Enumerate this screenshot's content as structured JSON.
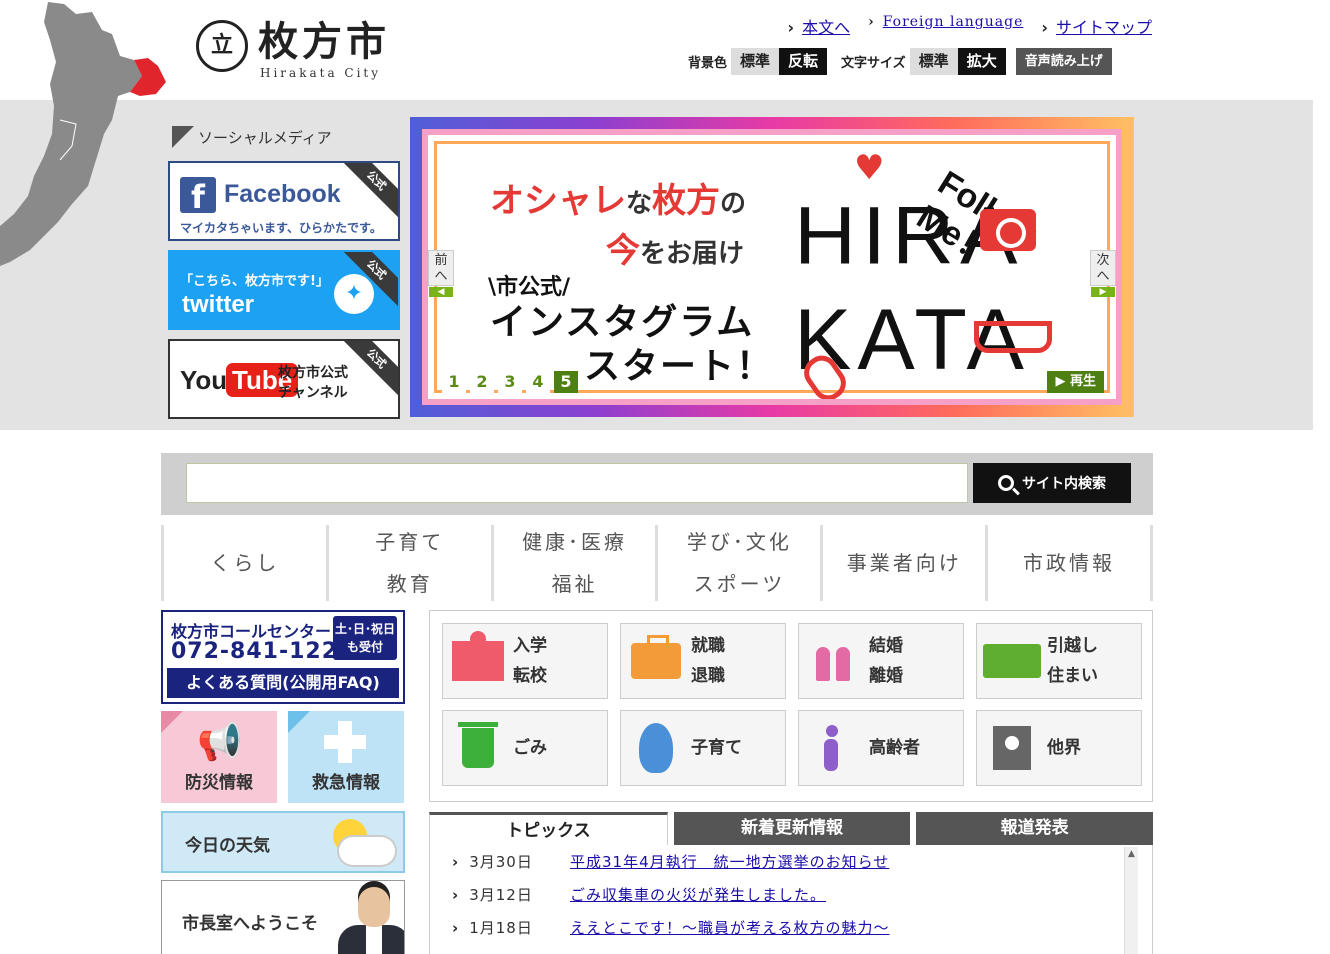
{
  "header": {
    "logo_mark": "立",
    "logo_name": "枚方市",
    "logo_roman": "Hirakata City",
    "links": [
      "本文へ",
      "Foreign language",
      "サイトマップ"
    ],
    "bg_label": "背景色",
    "bg_normal": "標準",
    "bg_invert": "反転",
    "size_label": "文字サイズ",
    "size_normal": "標準",
    "size_large": "拡大",
    "voice": "音声読み上げ"
  },
  "social": {
    "heading": "ソーシャルメディア",
    "corner": "公式",
    "facebook_title": "Facebook",
    "facebook_sub": "マイカタちゃいます、ひらかたです。",
    "twitter_sub": "「こちら、枚方市です!」",
    "twitter_title": "twitter",
    "youtube_you": "You",
    "youtube_tube": "Tube",
    "youtube_line1": "枚方市公式",
    "youtube_line2": "チャンネル"
  },
  "banner": {
    "line1_red": "オシャレ",
    "line1_mid": "な",
    "line1_red2": "枚方",
    "line1_end": "の",
    "line2_red": "今",
    "line2_end": "をお届け",
    "line3": "\\市公式/",
    "line4": "インスタグラム",
    "line5": "スタート！",
    "hira": "HIRA",
    "kata": "KATA",
    "follow": "Follow Me！",
    "prev": "前へ",
    "next": "次へ",
    "pages": [
      "1",
      "2",
      "3",
      "4",
      "5"
    ],
    "play": "▶ 再生",
    "colors": {
      "accent_red": "#e53935",
      "pager_green": "#4d7f11"
    }
  },
  "search": {
    "button_label": "サイト内検索",
    "placeholder": ""
  },
  "gnav": [
    {
      "l1": "くらし",
      "l2": ""
    },
    {
      "l1": "子育て",
      "l2": "教育"
    },
    {
      "l1": "健康･医療",
      "l2": "福祉"
    },
    {
      "l1": "学び･文化",
      "l2": "スポーツ"
    },
    {
      "l1": "事業者向け",
      "l2": ""
    },
    {
      "l1": "市政情報",
      "l2": ""
    }
  ],
  "callcenter": {
    "title": "枚方市コールセンター",
    "phone": "072-841-1221",
    "badge_1": "土･日･祝日",
    "badge_2": "も受付",
    "faq": "よくある質問(公開用FAQ)"
  },
  "tiles": {
    "bousai": "防災情報",
    "kyukyu": "救急情報",
    "weather": "今日の天気",
    "mayor": "市長室へようこそ"
  },
  "life": [
    {
      "l1": "入学",
      "l2": "転校",
      "icon": "school-icon"
    },
    {
      "l1": "就職",
      "l2": "退職",
      "icon": "briefcase-icon"
    },
    {
      "l1": "結婚",
      "l2": "離婚",
      "icon": "couple-icon"
    },
    {
      "l1": "引越し",
      "l2": "住まい",
      "icon": "truck-icon"
    },
    {
      "l1": "ごみ",
      "l2": "",
      "icon": "trash-icon"
    },
    {
      "l1": "子育て",
      "l2": "",
      "icon": "baby-icon"
    },
    {
      "l1": "高齢者",
      "l2": "",
      "icon": "elder-icon"
    },
    {
      "l1": "他界",
      "l2": "",
      "icon": "portrait-icon"
    }
  ],
  "tabs": [
    "トピックス",
    "新着更新情報",
    "報道発表"
  ],
  "news": [
    {
      "date": "3月30日",
      "title": "平成31年4月執行　統一地方選挙のお知らせ"
    },
    {
      "date": "3月12日",
      "title": "ごみ収集車の火災が発生しました。"
    },
    {
      "date": "1月18日",
      "title": "ええとこです！～職員が考える枚方の魅力～"
    }
  ]
}
